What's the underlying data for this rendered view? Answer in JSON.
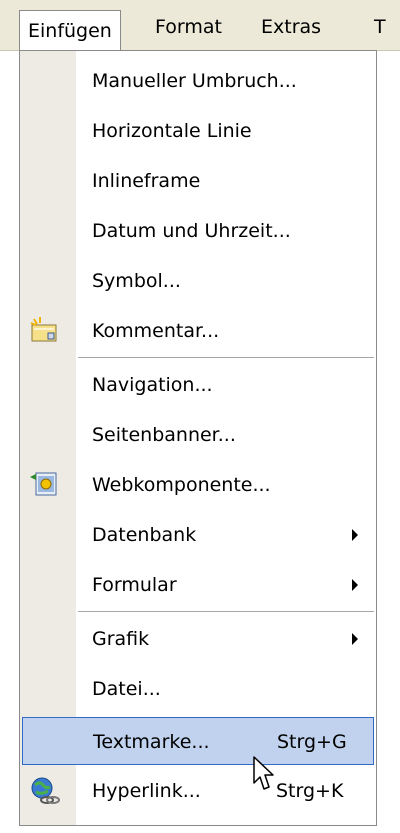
{
  "menubar": {
    "items": [
      "Einfügen",
      "Format",
      "Extras",
      "T"
    ]
  },
  "menu": {
    "items": [
      {
        "label": "Manueller Umbruch...",
        "icon": "",
        "submenu": false,
        "shortcut": ""
      },
      {
        "label": "Horizontale Linie",
        "icon": "",
        "submenu": false,
        "shortcut": ""
      },
      {
        "label": "Inlineframe",
        "icon": "",
        "submenu": false,
        "shortcut": ""
      },
      {
        "label": "Datum und Uhrzeit...",
        "icon": "",
        "submenu": false,
        "shortcut": ""
      },
      {
        "label": "Symbol...",
        "icon": "",
        "submenu": false,
        "shortcut": ""
      },
      {
        "label": "Kommentar...",
        "icon": "comment-icon",
        "submenu": false,
        "shortcut": ""
      },
      {
        "label": "Navigation...",
        "icon": "",
        "submenu": false,
        "shortcut": ""
      },
      {
        "label": "Seitenbanner...",
        "icon": "",
        "submenu": false,
        "shortcut": ""
      },
      {
        "label": "Webkomponente...",
        "icon": "web-component-icon",
        "submenu": false,
        "shortcut": ""
      },
      {
        "label": "Datenbank",
        "icon": "",
        "submenu": true,
        "shortcut": ""
      },
      {
        "label": "Formular",
        "icon": "",
        "submenu": true,
        "shortcut": ""
      },
      {
        "label": "Grafik",
        "icon": "",
        "submenu": true,
        "shortcut": ""
      },
      {
        "label": "Datei...",
        "icon": "",
        "submenu": false,
        "shortcut": ""
      },
      {
        "label": "Textmarke...",
        "icon": "",
        "submenu": false,
        "shortcut": "Strg+G",
        "highlighted": true
      },
      {
        "label": "Hyperlink...",
        "icon": "hyperlink-icon",
        "submenu": false,
        "shortcut": "Strg+K"
      }
    ]
  },
  "colors": {
    "menubar_bg": "#ece9d8",
    "gutter_bg": "#edebe4",
    "highlight_bg": "#c1d2ee",
    "highlight_border": "#316ac5"
  }
}
